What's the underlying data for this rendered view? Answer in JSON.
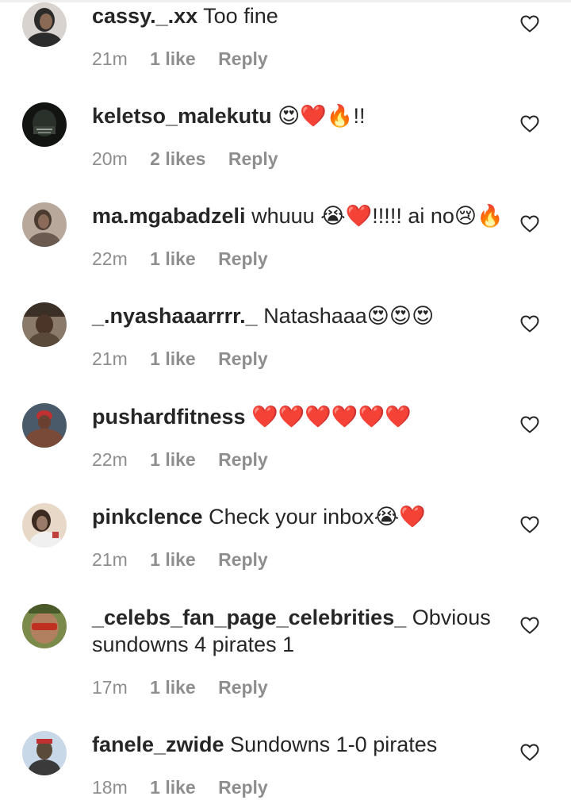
{
  "comments": [
    {
      "username": "cassy._.xx",
      "text": "Too fine",
      "time": "21m",
      "likes": "1 like",
      "reply": "Reply",
      "avatar_color": "#2b2b2b"
    },
    {
      "username": "keletso_malekutu",
      "text": "😍❤️🔥!!",
      "time": "20m",
      "likes": "2 likes",
      "reply": "Reply",
      "avatar_color": "#1b1f1b"
    },
    {
      "username": "ma.mgabadzeli",
      "text": "whuuu 😭❤️!!!!! ai no😢🔥",
      "time": "22m",
      "likes": "1 like",
      "reply": "Reply",
      "avatar_color": "#8a6b5a"
    },
    {
      "username": "_.nyashaaarrrr._",
      "text": "Natashaaa😍😍😍",
      "time": "21m",
      "likes": "1 like",
      "reply": "Reply",
      "avatar_color": "#6b5a4a"
    },
    {
      "username": "pushardfitness",
      "text": "❤️❤️❤️❤️❤️❤️",
      "time": "22m",
      "likes": "1 like",
      "reply": "Reply",
      "avatar_color": "#3a3030"
    },
    {
      "username": "pinkclence",
      "text": "Check your inbox😭❤️",
      "time": "21m",
      "likes": "1 like",
      "reply": "Reply",
      "avatar_color": "#9a7b6a"
    },
    {
      "username": "_celebs_fan_page_celebrities_",
      "text": "Obvious sundowns 4 pirates 1",
      "time": "17m",
      "likes": "1 like",
      "reply": "Reply",
      "avatar_color": "#7a8a4a"
    },
    {
      "username": "fanele_zwide",
      "text": "Sundowns 1-0 pirates",
      "time": "18m",
      "likes": "1 like",
      "reply": "Reply",
      "avatar_color": "#5a4a3a"
    }
  ],
  "icons": {
    "like": "heart-outline-icon"
  },
  "colors": {
    "text": "#262626",
    "meta": "#8e8e8e",
    "background": "#ffffff"
  }
}
